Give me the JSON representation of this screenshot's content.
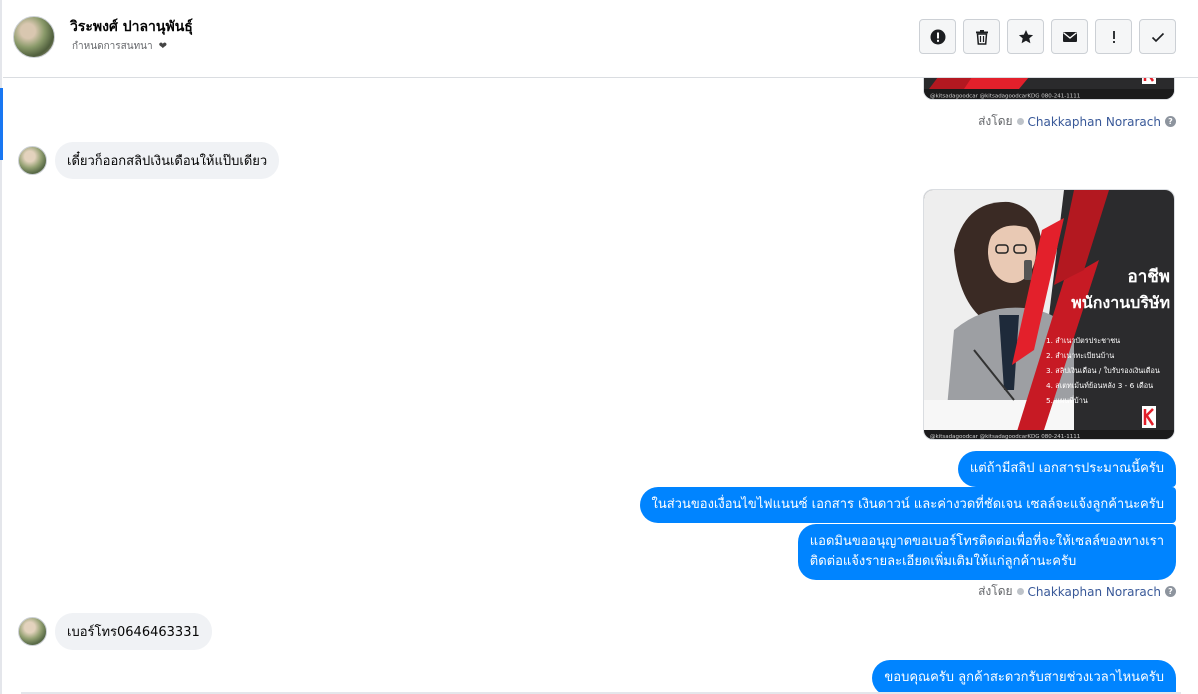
{
  "header": {
    "name": "วิระพงศ์ ปาลานุพันธุ์",
    "subtitle": "กำหนดการสนทนา"
  },
  "toolbar": [
    {
      "name": "report-button",
      "icon": "alert-circle-icon"
    },
    {
      "name": "delete-button",
      "icon": "trash-icon"
    },
    {
      "name": "star-button",
      "icon": "star-icon"
    },
    {
      "name": "mark-unread-button",
      "icon": "envelope-icon"
    },
    {
      "name": "important-button",
      "icon": "exclamation-icon"
    },
    {
      "name": "done-button",
      "icon": "checkmark-icon"
    }
  ],
  "colors": {
    "outgoing_bubble": "#0084ff",
    "incoming_bubble": "#f0f2f5",
    "agent_link": "#385898",
    "accent": "#1877f2",
    "card_red": "#e3202b"
  },
  "sent_by": {
    "prefix": "ส่งโดย",
    "agent": "Chakkaphan Norarach"
  },
  "messages": {
    "incoming_1": "เดี๋ยวก็ออกสลิปเงินเดือนให้แป๊บเดียว",
    "outgoing_1": "แต่ถ้ามีสลิป เอกสารประมาณนี้ครับ",
    "outgoing_2": "ในส่วนของเงื่อนไขไฟแนนซ์ เอกสาร เงินดาวน์ และค่างวดที่ชัดเจน เซลล์จะแจ้งลูกค้านะครับ",
    "outgoing_3a": "แอดมินขออนุญาตขอเบอร์โทรติดต่อเพื่อที่จะให้เซลล์ของทางเรา",
    "outgoing_3b": "ติดต่อแจ้งรายละเอียดเพิ่มเติมให้แก่ลูกค้านะครับ",
    "incoming_2": "เบอร์โทร0646463331",
    "outgoing_4": "ขอบคุณครับ ลูกค้าสะดวกรับสายช่วงเวลาไหนครับ"
  },
  "card_top": {
    "footer": "@kitsadagoodcar   @kitsadagoodcarKDG   080-241-1111"
  },
  "card": {
    "heading1": "อาชีพ",
    "heading2": "พนักงานบริษัท",
    "list": [
      "1. สำเนาบัตรประชาชน",
      "2. สำเนาทะเบียนบ้าน",
      "3. สลิปเงินเดือน / ใบรับรองเงินเดือน",
      "4. สเตทเม้นท์ย้อนหลัง 3 - 6 เดือน",
      "5. แผนที่บ้าน"
    ],
    "footer": "@kitsadagoodcar   @kitsadagoodcarKDG   080-241-1111"
  }
}
